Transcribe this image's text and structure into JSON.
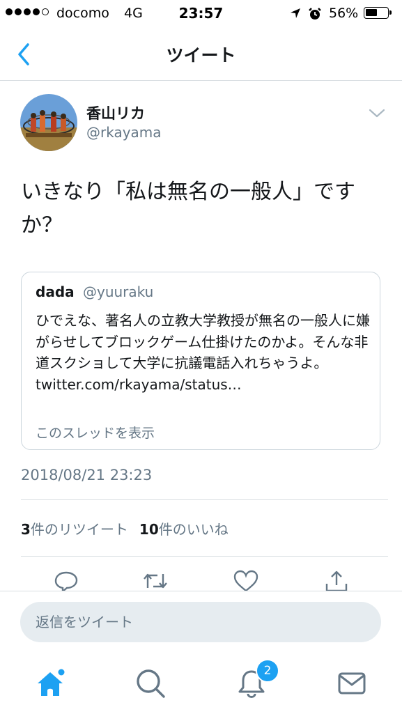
{
  "status_bar": {
    "carrier": "docomo",
    "network": "4G",
    "time": "23:57",
    "battery": "56%",
    "battery_level": 0.56,
    "icons": [
      "signal-dots",
      "location-arrow-icon",
      "alarm-icon",
      "battery-icon"
    ]
  },
  "nav": {
    "title": "ツイート",
    "back_icon": "chevron-left-icon"
  },
  "tweet": {
    "name": "香山リカ",
    "handle": "@rkayama",
    "text": "いきなり「私は無名の一般人」ですか？",
    "timestamp": "2018/08/21 23:23"
  },
  "quote": {
    "name": "dada",
    "handle": "@yuuraku",
    "text": "ひでえな、著名人の立教大学教授が無名の一般人に嫌がらせしてブロックゲーム仕掛けたのかよ。そんな非道スクショして大学に抗議電話入れちゃうよ。 twitter.com/rkayama/status…",
    "thread_link": "このスレッドを表示"
  },
  "stats": {
    "retweet_count": "3",
    "retweet_label": "件のリツイート",
    "like_count": "10",
    "like_label": "件のいいね"
  },
  "actions": [
    "reply-icon",
    "retweet-icon",
    "like-icon",
    "share-icon"
  ],
  "reply": {
    "placeholder": "返信をツイート"
  },
  "tab_bar": {
    "items": [
      "home-icon",
      "search-icon",
      "notifications-icon",
      "messages-icon"
    ],
    "notification_badge": "2"
  },
  "colors": {
    "accent": "#1da1f2",
    "secondary_text": "#657786",
    "divider": "#d8dde1"
  }
}
